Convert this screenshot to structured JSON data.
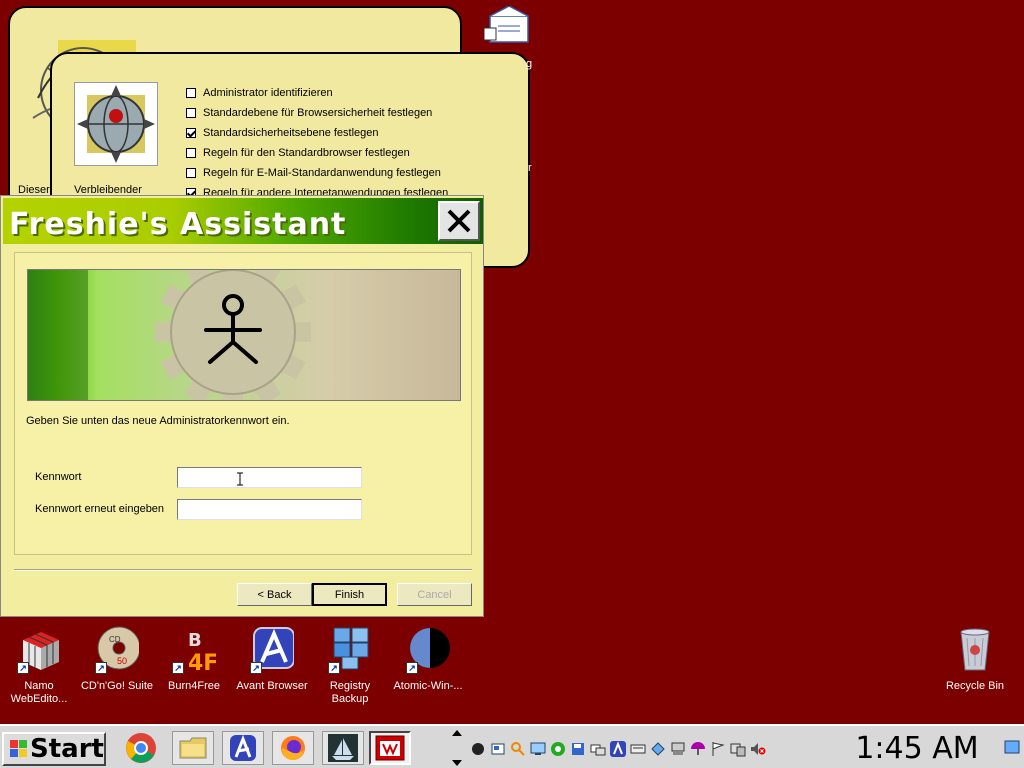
{
  "desktop": {
    "icons": [
      {
        "label": "Namo WebEdito...",
        "icon": "rubiks-cube-icon"
      },
      {
        "label": "CD'n'Go! Suite",
        "icon": "cd-disc-icon"
      },
      {
        "label": "Burn4Free",
        "icon": "burn4free-icon"
      },
      {
        "label": "Avant Browser",
        "icon": "avant-browser-icon"
      },
      {
        "label": "Registry Backup",
        "icon": "registry-cubes-icon"
      },
      {
        "label": "Atomic-Win-...",
        "icon": "atomic-clock-icon"
      }
    ],
    "recycle_bin": {
      "label": "Recycle Bin"
    },
    "partial_icon_texts": [
      "g",
      "r"
    ]
  },
  "back_window_1": {
    "label": "Dieser"
  },
  "back_window_2": {
    "label": "Verbleibender",
    "checkboxes": [
      {
        "label": "Administrator identifizieren",
        "checked": false
      },
      {
        "label": "Standardebene für Browsersicherheit festlegen",
        "checked": false
      },
      {
        "label": "Standardsicherheitsebene festlegen",
        "checked": true
      },
      {
        "label": "Regeln für den Standardbrowser festlegen",
        "checked": false
      },
      {
        "label": "Regeln für E-Mail-Standardanwendung festlegen",
        "checked": false
      },
      {
        "label": "Regeln für andere Internetanwendungen festlegen",
        "checked": true
      }
    ]
  },
  "dialog": {
    "title": "Freshie's Assistant",
    "prompt": "Geben Sie unten das neue Administratorkennwort ein.",
    "password_label": "Kennwort",
    "password_value": "",
    "confirm_label": "Kennwort erneut eingeben",
    "confirm_value": "",
    "buttons": {
      "back": "< Back",
      "finish": "Finish",
      "cancel": "Cancel"
    }
  },
  "taskbar": {
    "start_label": "Start",
    "quick_launch": [
      "chrome-icon",
      "folder-icon",
      "avant-browser-icon",
      "firefox-icon",
      "ship-icon",
      "calendar-app-icon"
    ],
    "tray_icons": [
      "circle-icon",
      "network-icon",
      "search-icon",
      "monitor-icon",
      "chat-icon",
      "floppy-icon",
      "network-icon",
      "avant-icon",
      "keyboard-icon",
      "network-globe-icon",
      "computer-icon",
      "umbrella-icon",
      "flag-icon",
      "computer-icon",
      "volume-muted-icon"
    ],
    "clock": "1:45 AM"
  },
  "colors": {
    "desktop": "#7d0000",
    "window_face": "#f3eda0",
    "title_gradient_start": "#b4d200",
    "title_gradient_end": "#105e00"
  }
}
